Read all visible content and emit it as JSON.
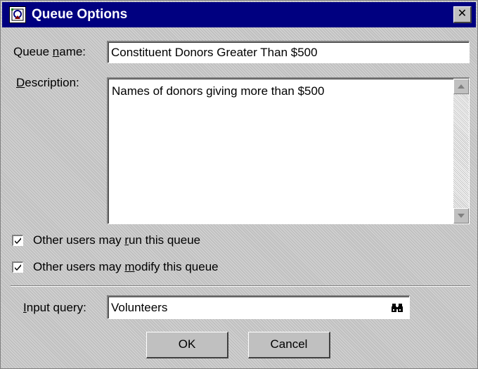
{
  "dialog": {
    "title": "Queue Options",
    "close_label": "✕"
  },
  "queue_name": {
    "label_pre": "Queue ",
    "label_mnemonic": "n",
    "label_post": "ame:",
    "value": "Constituent Donors Greater Than $500"
  },
  "description": {
    "label_pre": "",
    "label_mnemonic": "D",
    "label_post": "escription:",
    "value": "Names of donors giving more than $500"
  },
  "options": {
    "run": {
      "label_pre": "Other users may ",
      "label_mnemonic": "r",
      "label_post": "un this queue",
      "checked": true
    },
    "modify": {
      "label_pre": "Other users may ",
      "label_mnemonic": "m",
      "label_post": "odify this queue",
      "checked": true
    }
  },
  "input_query": {
    "label_pre": "",
    "label_mnemonic": "I",
    "label_post": "nput query:",
    "value": "Volunteers",
    "browse_icon": "binoculars-icon"
  },
  "buttons": {
    "ok": "OK",
    "cancel": "Cancel"
  },
  "colors": {
    "titlebar": "#000080",
    "face": "#c0c0c0"
  }
}
